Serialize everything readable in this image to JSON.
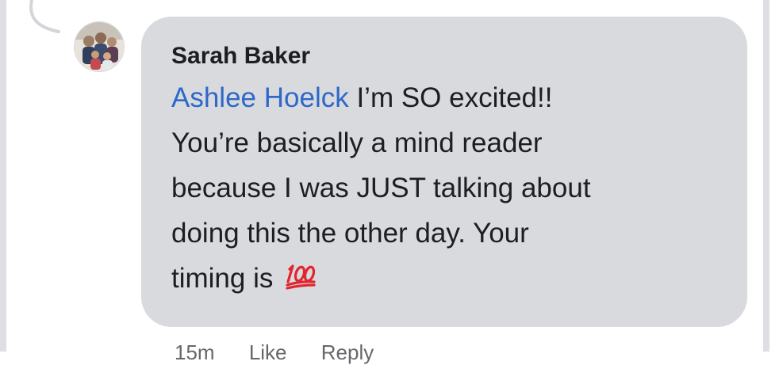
{
  "comment": {
    "author": "Sarah Baker",
    "mention": "Ashlee Hoelck",
    "body_line1": " I’m SO excited!!",
    "body_line2": "You’re basically a mind reader",
    "body_line3": "because I was JUST talking about",
    "body_line4": "doing this the other day. Your",
    "body_line5": "timing is ",
    "emoji": "hundred-points-emoji"
  },
  "footer": {
    "time": "15m",
    "like_label": "Like",
    "reply_label": "Reply"
  },
  "colors": {
    "bubble": "#d9dade",
    "mention": "#2e68c9",
    "text": "#1c1e21",
    "emoji": "#e0262f"
  }
}
